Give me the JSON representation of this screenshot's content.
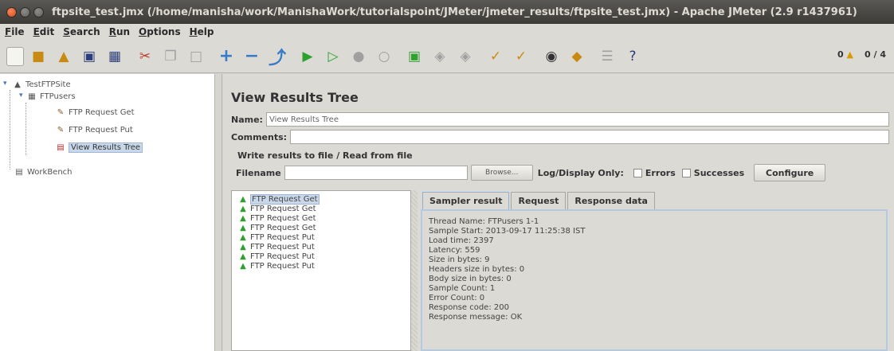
{
  "window": {
    "title": "ftpsite_test.jmx (/home/manisha/work/ManishaWork/tutorialspoint/JMeter/jmeter_results/ftpsite_test.jmx) - Apache JMeter (2.9 r1437961)"
  },
  "menu": {
    "items": [
      "File",
      "Edit",
      "Search",
      "Run",
      "Options",
      "Help"
    ]
  },
  "toolbar": {
    "warnings": "0",
    "threads": "0 / 4"
  },
  "tree": {
    "root": "TestFTPSite",
    "thread_group": "FTPusers",
    "items": [
      "FTP Request Get",
      "FTP Request Put",
      "View Results Tree"
    ],
    "workbench": "WorkBench"
  },
  "panel": {
    "title": "View Results Tree",
    "name_label": "Name:",
    "name_value": "View Results Tree",
    "comments_label": "Comments:",
    "fieldset_title": "Write results to file / Read from file",
    "filename_label": "Filename",
    "browse_label": "Browse...",
    "log_display_label": "Log/Display Only:",
    "errors_label": "Errors",
    "successes_label": "Successes",
    "configure_label": "Configure"
  },
  "results": {
    "items": [
      "FTP Request Get",
      "FTP Request Get",
      "FTP Request Get",
      "FTP Request Get",
      "FTP Request Put",
      "FTP Request Put",
      "FTP Request Put",
      "FTP Request Put"
    ]
  },
  "tabs": [
    "Sampler result",
    "Request",
    "Response data"
  ],
  "sampler_result": {
    "lines": [
      "Thread Name: FTPusers 1-1",
      "Sample Start: 2013-09-17 11:25:38 IST",
      "Load time: 2397",
      "Latency: 559",
      "Size in bytes: 9",
      "Headers size in bytes: 0",
      "Body size in bytes: 0",
      "Sample Count: 1",
      "Error Count: 0",
      "Response code: 200",
      "Response message: OK"
    ]
  }
}
